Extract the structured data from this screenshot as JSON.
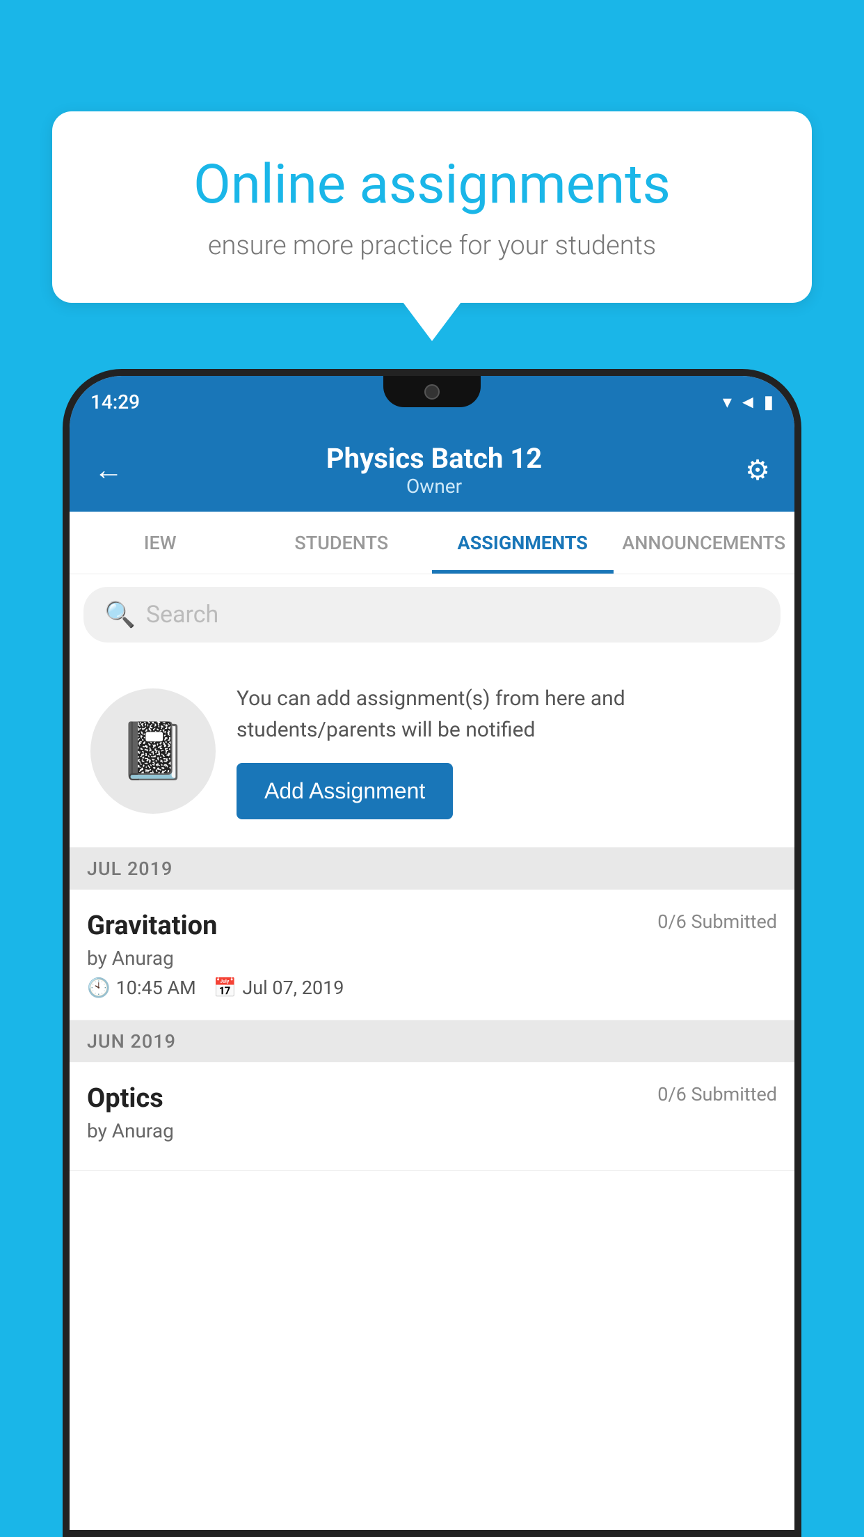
{
  "background_color": "#1ab6e8",
  "speech_bubble": {
    "title": "Online assignments",
    "subtitle": "ensure more practice for your students"
  },
  "status_bar": {
    "time": "14:29",
    "icons": [
      "wifi",
      "signal",
      "battery"
    ]
  },
  "header": {
    "title": "Physics Batch 12",
    "subtitle": "Owner",
    "back_label": "←",
    "settings_label": "⚙"
  },
  "tabs": [
    {
      "label": "IEW",
      "active": false
    },
    {
      "label": "STUDENTS",
      "active": false
    },
    {
      "label": "ASSIGNMENTS",
      "active": true
    },
    {
      "label": "ANNOUNCEMENTS",
      "active": false
    }
  ],
  "search": {
    "placeholder": "Search"
  },
  "promo": {
    "description": "You can add assignment(s) from here and students/parents will be notified",
    "button_label": "Add Assignment"
  },
  "sections": [
    {
      "month": "JUL 2019",
      "assignments": [
        {
          "name": "Gravitation",
          "submitted": "0/6 Submitted",
          "author": "by Anurag",
          "time": "10:45 AM",
          "date": "Jul 07, 2019"
        }
      ]
    },
    {
      "month": "JUN 2019",
      "assignments": [
        {
          "name": "Optics",
          "submitted": "0/6 Submitted",
          "author": "by Anurag",
          "time": "",
          "date": ""
        }
      ]
    }
  ]
}
